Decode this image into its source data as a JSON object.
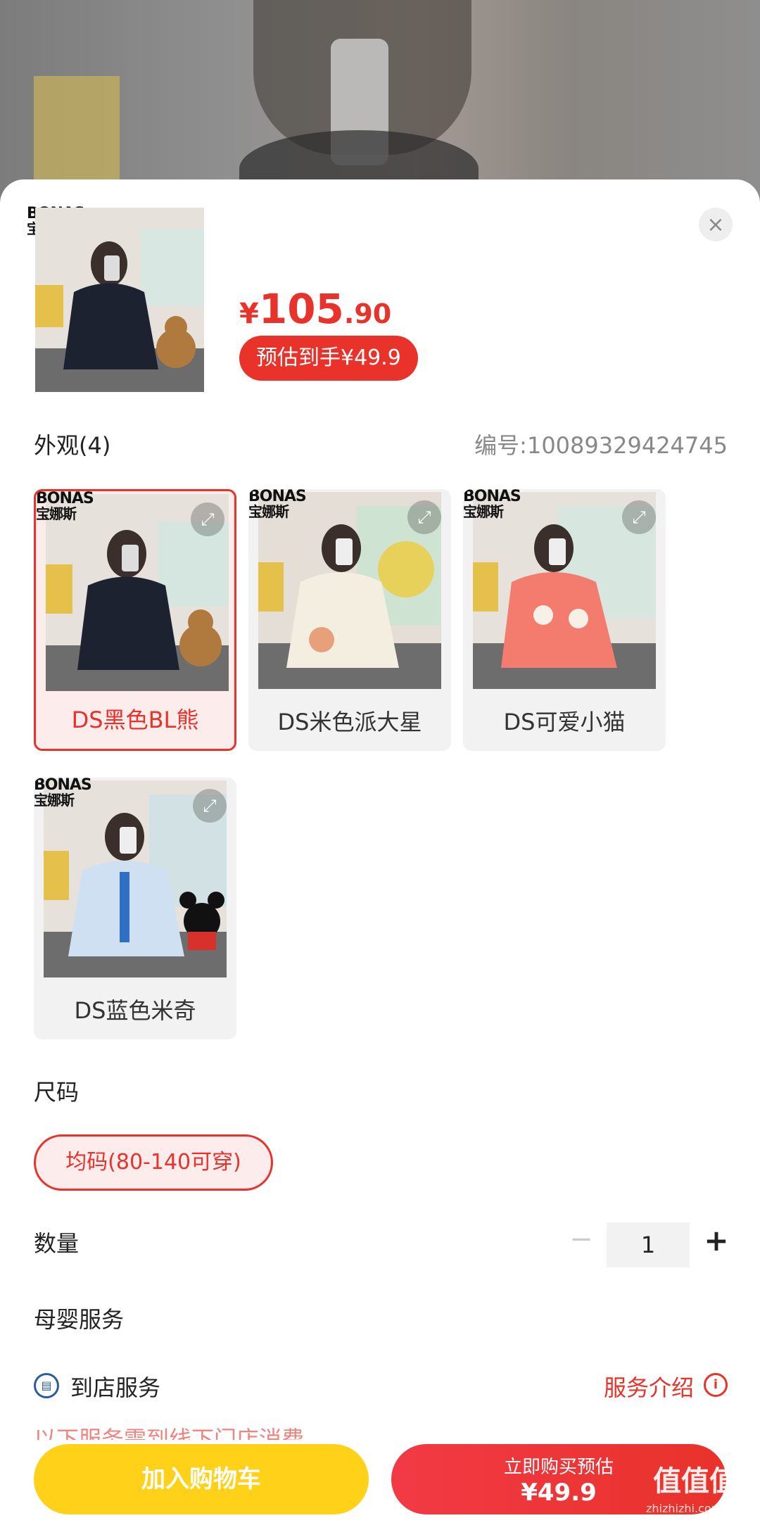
{
  "product": {
    "brand_en": "BONAS",
    "brand_cn": "宝娜斯",
    "price_currency": "¥",
    "price_integer": "105",
    "price_decimal": ".90",
    "estimated_label": "预估到手¥49.9"
  },
  "close_label": "×",
  "appearance": {
    "title": "外观(4)",
    "sku_code": "编号:1008932942474​5",
    "options": [
      {
        "label": "DS黑色BL熊",
        "selected": true
      },
      {
        "label": "DS米色派大星",
        "selected": false
      },
      {
        "label": "DS可爱小猫",
        "selected": false
      },
      {
        "label": "DS蓝色米奇",
        "selected": false
      }
    ]
  },
  "size": {
    "title": "尺码",
    "option": "均码(80-140可穿)"
  },
  "quantity": {
    "title": "数量",
    "minus": "−",
    "value": "1",
    "plus": "+"
  },
  "service": {
    "title": "母婴服务",
    "store_label": "到店服务",
    "link_label": "服务介绍",
    "cutoff_text": "以下服务需到线下门店消费"
  },
  "actions": {
    "add_cart": "加入购物车",
    "buy_line1": "立即购买预估",
    "buy_line2": "¥49.9"
  },
  "watermark": {
    "text": "值值值",
    "url": "zhizhizhi.com"
  },
  "colors": {
    "accent_red": "#e8322a",
    "cart_yellow": "#ffd118"
  }
}
